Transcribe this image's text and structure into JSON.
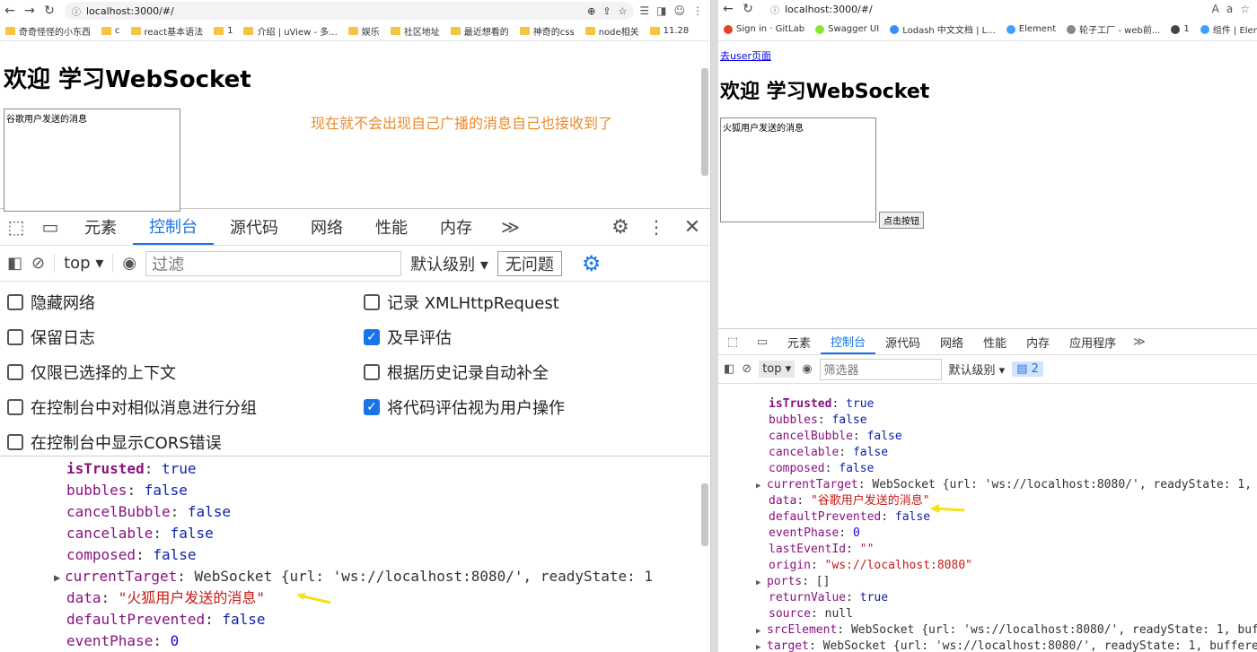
{
  "left_window": {
    "url": "localhost:3000/#/",
    "bookmarks": [
      "奇奇怪怪的小东西",
      "c",
      "react基本语法",
      "1",
      "介绍 | uView - 多...",
      "娱乐",
      "社区地址",
      "最近想看的",
      "神奇的css",
      "node相关",
      "11.28"
    ],
    "page_title": "欢迎 学习WebSocket",
    "textarea_value": "谷歌用户发送的消息",
    "annotation": "现在就不会出现自己广播的消息自己也接收到了",
    "devtools_tabs": [
      "元素",
      "控制台",
      "源代码",
      "网络",
      "性能",
      "内存"
    ],
    "active_tab": "控制台",
    "context": "top",
    "filter_placeholder": "过滤",
    "level": "默认级别",
    "issues": "无问题",
    "settings": [
      {
        "label": "隐藏网络",
        "checked": false
      },
      {
        "label": "记录 XMLHttpRequest",
        "checked": false
      },
      {
        "label": "保留日志",
        "checked": false
      },
      {
        "label": "及早评估",
        "checked": true
      },
      {
        "label": "仅限已选择的上下文",
        "checked": false
      },
      {
        "label": "根据历史记录自动补全",
        "checked": false
      },
      {
        "label": "在控制台中对相似消息进行分组",
        "checked": false
      },
      {
        "label": "将代码评估视为用户操作",
        "checked": true
      },
      {
        "label": "在控制台中显示CORS错误",
        "checked": false
      }
    ],
    "console": [
      {
        "key": "isTrusted",
        "val": "true",
        "type": "bool",
        "own": true
      },
      {
        "key": "bubbles",
        "val": "false",
        "type": "bool"
      },
      {
        "key": "cancelBubble",
        "val": "false",
        "type": "bool"
      },
      {
        "key": "cancelable",
        "val": "false",
        "type": "bool"
      },
      {
        "key": "composed",
        "val": "false",
        "type": "bool"
      },
      {
        "key": "currentTarget",
        "val": "WebSocket {url: 'ws://localhost:8080/', readyState: 1",
        "type": "obj",
        "expand": true
      },
      {
        "key": "data",
        "val": "\"火狐用户发送的消息\"",
        "type": "str",
        "marked": true
      },
      {
        "key": "defaultPrevented",
        "val": "false",
        "type": "bool"
      },
      {
        "key": "eventPhase",
        "val": "0",
        "type": "num"
      }
    ]
  },
  "right_window": {
    "url": "localhost:3000/#/",
    "bookmarks": [
      "Sign in · GitLab",
      "Swagger UI",
      "Lodash 中文文档 | L...",
      "Element",
      "轮子工厂 - web前...",
      "1",
      "组件 | Element"
    ],
    "link": "去user页面",
    "page_title": "欢迎 学习WebSocket",
    "textarea_value": "火狐用户发送的消息",
    "button": "点击按钮",
    "devtools_tabs": [
      "元素",
      "控制台",
      "源代码",
      "网络",
      "性能",
      "内存",
      "应用程序"
    ],
    "active_tab": "控制台",
    "context": "top",
    "filter_placeholder": "筛选器",
    "level": "默认级别",
    "badge": "2",
    "console": [
      {
        "key": "isTrusted",
        "val": "true",
        "type": "bool",
        "own": true
      },
      {
        "key": "bubbles",
        "val": "false",
        "type": "bool"
      },
      {
        "key": "cancelBubble",
        "val": "false",
        "type": "bool"
      },
      {
        "key": "cancelable",
        "val": "false",
        "type": "bool"
      },
      {
        "key": "composed",
        "val": "false",
        "type": "bool"
      },
      {
        "key": "currentTarget",
        "val": "WebSocket {url: 'ws://localhost:8080/', readyState: 1, buf",
        "type": "obj",
        "expand": true
      },
      {
        "key": "data",
        "val": "\"谷歌用户发送的消息\"",
        "type": "str",
        "marked": true
      },
      {
        "key": "defaultPrevented",
        "val": "false",
        "type": "bool"
      },
      {
        "key": "eventPhase",
        "val": "0",
        "type": "num"
      },
      {
        "key": "lastEventId",
        "val": "\"\"",
        "type": "str"
      },
      {
        "key": "origin",
        "val": "\"ws://localhost:8080\"",
        "type": "str"
      },
      {
        "key": "ports",
        "val": "[]",
        "type": "obj",
        "expand": true
      },
      {
        "key": "returnValue",
        "val": "true",
        "type": "bool"
      },
      {
        "key": "source",
        "val": "null",
        "type": "plain"
      },
      {
        "key": "srcElement",
        "val": "WebSocket {url: 'ws://localhost:8080/', readyState: 1, buffer",
        "type": "obj",
        "expand": true
      },
      {
        "key": "target",
        "val": "WebSocket {url: 'ws://localhost:8080/', readyState: 1, bufferedAm",
        "type": "obj",
        "expand": true
      }
    ]
  },
  "colors": {
    "accent": "#1a73e8",
    "annotation": "#e88b2e",
    "arrow": "#f5e11a"
  }
}
